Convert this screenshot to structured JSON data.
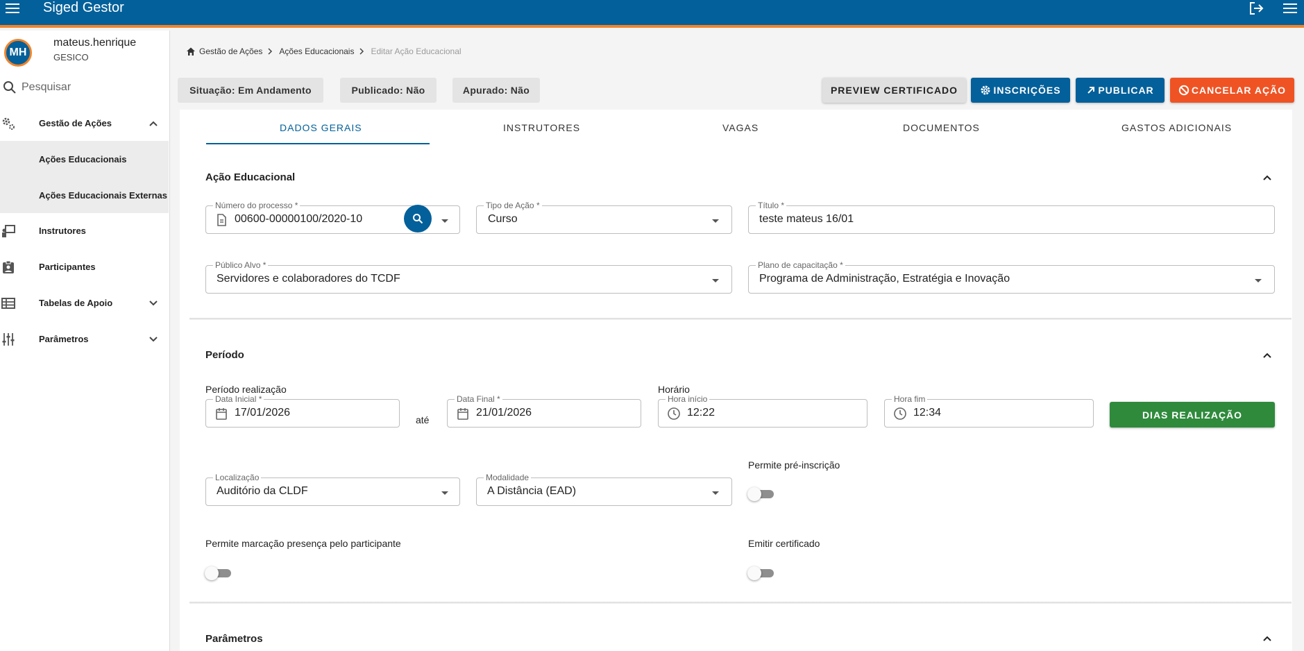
{
  "app": {
    "title": "Siged Gestor"
  },
  "user": {
    "initials": "MH",
    "name": "mateus.henrique",
    "org": "GESICO"
  },
  "sidebar": {
    "search_placeholder": "Pesquisar",
    "items": [
      {
        "label": "Gestão de Ações",
        "icon": "gears-icon"
      },
      {
        "label": "Ações Educacionais"
      },
      {
        "label": "Ações Educacionais Externas"
      },
      {
        "label": "Instrutores",
        "icon": "instructor-icon"
      },
      {
        "label": "Participantes",
        "icon": "badge-icon"
      },
      {
        "label": "Tabelas de Apoio",
        "icon": "table-icon"
      },
      {
        "label": "Parâmetros",
        "icon": "sliders-icon"
      }
    ]
  },
  "breadcrumb": {
    "items": [
      "Gestão de Ações",
      "Ações Educacionais",
      "Editar Ação Educacional"
    ]
  },
  "status": {
    "situacao": "Situação: Em Andamento",
    "publicado": "Publicado: Não",
    "apurado": "Apurado: Não"
  },
  "actions": {
    "preview": "PREVIEW CERTIFICADO",
    "inscricoes": "INSCRIÇÕES",
    "publicar": "PUBLICAR",
    "cancelar": "CANCELAR AÇÃO"
  },
  "tabs": [
    "DADOS GERAIS",
    "INSTRUTORES",
    "VAGAS",
    "DOCUMENTOS",
    "GASTOS ADICIONAIS"
  ],
  "acao_educacional": {
    "title": "Ação Educacional",
    "numero_processo": {
      "label": "Número do processo *",
      "value": "00600-00000100/2020-10"
    },
    "tipo_acao": {
      "label": "Tipo de Ação *",
      "value": "Curso"
    },
    "titulo": {
      "label": "Título *",
      "value": "teste mateus 16/01"
    },
    "publico_alvo": {
      "label": "Público Alvo *",
      "value": "Servidores e colaboradores do TCDF"
    },
    "plano_capacitacao": {
      "label": "Plano de capacitação *",
      "value": "Programa de Administração, Estratégia e Inovação"
    }
  },
  "periodo": {
    "title": "Período",
    "periodo_label": "Período realização",
    "data_inicial": {
      "label": "Data Inicial *",
      "value": "17/01/2026"
    },
    "ate": "até",
    "data_final": {
      "label": "Data Final *",
      "value": "21/01/2026"
    },
    "horario_label": "Horário",
    "hora_inicio": {
      "label": "Hora início",
      "value": "12:22"
    },
    "hora_fim": {
      "label": "Hora fim",
      "value": "12:34"
    },
    "dias_button": "DIAS REALIZAÇÃO",
    "localizacao": {
      "label": "Localização",
      "value": "Auditório da CLDF"
    },
    "modalidade": {
      "label": "Modalidade",
      "value": "A Distância (EAD)"
    },
    "permite_pre_inscricao": {
      "label": "Permite pré-inscrição",
      "checked": false
    },
    "permite_marcacao": {
      "label": "Permite marcação presença pelo participante",
      "checked": false
    },
    "emitir_certificado": {
      "label": "Emitir certificado",
      "checked": false
    }
  },
  "parametros": {
    "title": "Parâmetros"
  },
  "colors": {
    "primary": "#03609a",
    "accent": "#f0832a",
    "danger": "#ef5324",
    "success": "#2f8a3c"
  }
}
